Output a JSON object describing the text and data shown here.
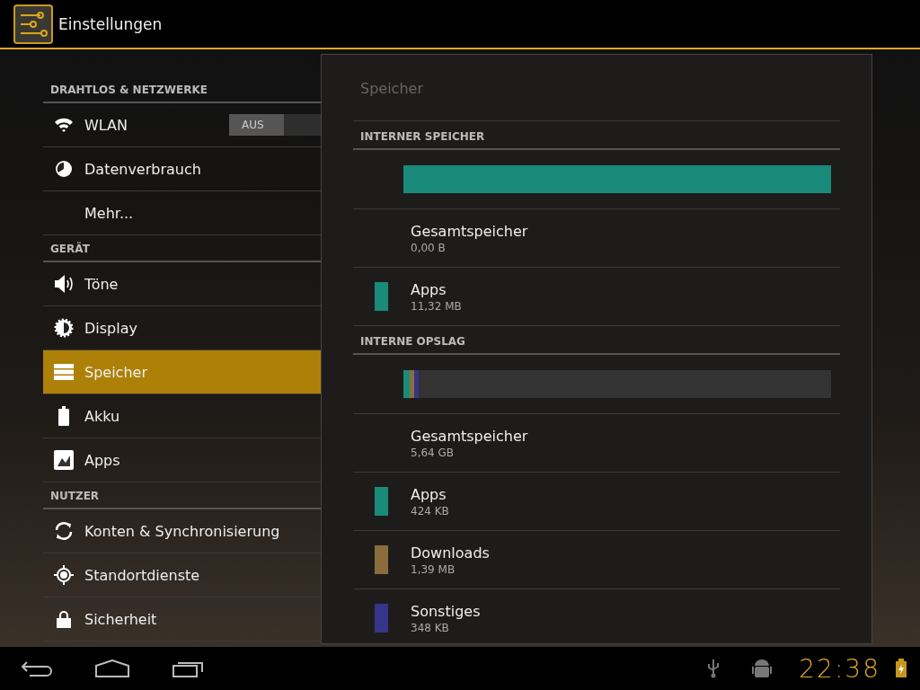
{
  "action_bar": {
    "title": "Einstellungen"
  },
  "sidebar": {
    "sections": [
      {
        "header": "DRAHTLOS & NETZWERKE",
        "items": [
          {
            "label": "WLAN",
            "selected": false,
            "toggle": {
              "label": "AUS",
              "on": false
            }
          },
          {
            "label": "Datenverbrauch",
            "selected": false
          },
          {
            "label": "Mehr...",
            "selected": false
          }
        ]
      },
      {
        "header": "GERÄT",
        "items": [
          {
            "label": "Töne",
            "selected": false
          },
          {
            "label": "Display",
            "selected": false
          },
          {
            "label": "Speicher",
            "selected": true
          },
          {
            "label": "Akku",
            "selected": false
          },
          {
            "label": "Apps",
            "selected": false
          }
        ]
      },
      {
        "header": "NUTZER",
        "items": [
          {
            "label": "Konten & Synchronisierung",
            "selected": false
          },
          {
            "label": "Standortdienste",
            "selected": false
          },
          {
            "label": "Sicherheit",
            "selected": false
          }
        ]
      }
    ]
  },
  "detail": {
    "title": "Speicher",
    "sections": [
      {
        "header": "INTERNER SPEICHER",
        "segments": [
          {
            "color": "#1a8a7a",
            "level": 1
          }
        ],
        "rows": [
          {
            "name": "Gesamtspeicher",
            "size": "0,00 B"
          },
          {
            "name": "Apps",
            "size": "11,32 MB",
            "color": "#1a8a7a"
          }
        ]
      },
      {
        "header": "INTERNE OPSLAG",
        "segments": [
          {
            "color": "#1a8a7a",
            "level": 0.014
          },
          {
            "color": "#8b6d3c",
            "level": 0.011
          },
          {
            "color": "#35358a",
            "level": 0.011
          }
        ],
        "rows": [
          {
            "name": "Gesamtspeicher",
            "size": "5,64 GB"
          },
          {
            "name": "Apps",
            "size": "424 KB",
            "color": "#1a8a7a"
          },
          {
            "name": "Downloads",
            "size": "1,39 MB",
            "color": "#8b6d3c"
          },
          {
            "name": "Sonstiges",
            "size": "348 KB",
            "color": "#35358a"
          }
        ]
      }
    ]
  },
  "system_bar": {
    "time": "22:38"
  }
}
